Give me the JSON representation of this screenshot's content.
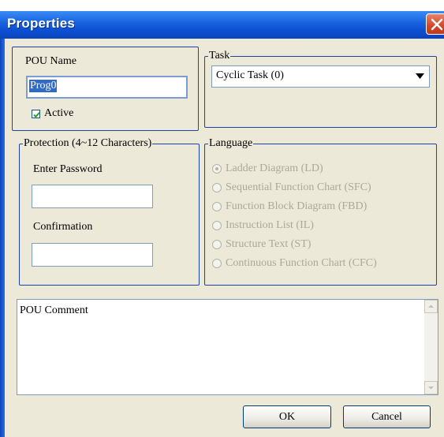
{
  "window": {
    "title": "Properties"
  },
  "pou": {
    "name_label": "POU Name",
    "name_value": "Prog0",
    "active_label": "Active",
    "active_checked": true
  },
  "task": {
    "group_title": "Task",
    "selected": "Cyclic Task (0)"
  },
  "protection": {
    "group_title": "Protection (4~12 Characters)",
    "password_label": "Enter Password",
    "password_value": "",
    "confirm_label": "Confirmation",
    "confirm_value": ""
  },
  "language": {
    "group_title": "Language",
    "selected_index": 0,
    "options": [
      {
        "label": "Ladder Diagram (LD)"
      },
      {
        "label": "Sequential Function Chart (SFC)"
      },
      {
        "label": "Function Block Diagram (FBD)"
      },
      {
        "label": "Instruction List (IL)"
      },
      {
        "label": "Structure Text (ST)"
      },
      {
        "label": "Continuous Function Chart (CFC)"
      }
    ]
  },
  "comment": {
    "text": "POU Comment"
  },
  "buttons": {
    "ok": "OK",
    "cancel": "Cancel"
  },
  "icons": {
    "close": "close-icon",
    "check": "check-icon",
    "dropdown": "chevron-down-icon",
    "scroll_up": "scroll-up-icon",
    "scroll_down": "scroll-down-icon"
  }
}
